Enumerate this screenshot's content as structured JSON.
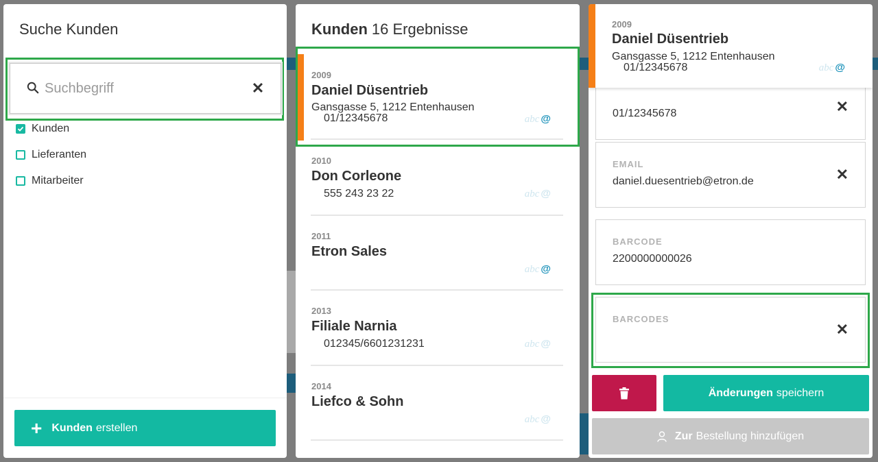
{
  "search_panel": {
    "title": "Suche Kunden",
    "search_placeholder": "Suchbegriff",
    "search_value": "",
    "filters": [
      {
        "label": "Kunden",
        "checked": true
      },
      {
        "label": "Lieferanten",
        "checked": false
      },
      {
        "label": "Mitarbeiter",
        "checked": false
      }
    ],
    "create_button": {
      "bold": "Kunden",
      "rest": "erstellen"
    }
  },
  "results_panel": {
    "title_bold": "Kunden",
    "title_rest": "16 Ergebnisse",
    "items": [
      {
        "year": "2009",
        "name": "Daniel Düsentrieb",
        "address": "Gansgasse 5, 1212 Entenhausen",
        "phone": "01/12345678",
        "abc": "abc",
        "at": "@",
        "email_active": true,
        "selected": true
      },
      {
        "year": "2010",
        "name": "Don Corleone",
        "address": "",
        "phone": "555 243 23 22",
        "abc": "abc",
        "at": "@",
        "email_active": false,
        "selected": false
      },
      {
        "year": "2011",
        "name": "Etron Sales",
        "address": "",
        "phone": "",
        "abc": "abc",
        "at": "@",
        "email_active": true,
        "selected": false
      },
      {
        "year": "2013",
        "name": "Filiale Narnia",
        "address": "",
        "phone": "012345/6601231231",
        "abc": "abc",
        "at": "@",
        "email_active": false,
        "selected": false
      },
      {
        "year": "2014",
        "name": "Liefco & Sohn",
        "address": "",
        "phone": "",
        "abc": "abc",
        "at": "@",
        "email_active": false,
        "selected": false
      }
    ]
  },
  "detail_panel": {
    "year": "2009",
    "name": "Daniel Düsentrieb",
    "address": "Gansgasse 5, 1212 Entenhausen",
    "phone": "01/12345678",
    "abc": "abc",
    "at": "@",
    "fields": [
      {
        "label": "",
        "value": "01/12345678",
        "clearable": true
      },
      {
        "label": "EMAIL",
        "value": "daniel.duesentrieb@etron.de",
        "clearable": true
      },
      {
        "label": "BARCODE",
        "value": "2200000000026",
        "clearable": false
      },
      {
        "label": "BARCODES",
        "value": "",
        "clearable": true
      }
    ],
    "save_button": {
      "bold": "Änderungen",
      "rest": "speichern"
    },
    "order_button": {
      "bold": "Zur",
      "rest": "Bestellung hinzufügen"
    },
    "clear_glyph": "✕"
  },
  "colors": {
    "accent": "#13b9a2",
    "selection": "#f57f17",
    "focus_frame": "#2ea84a",
    "delete": "#c0184b",
    "disabled": "#c7c7c7",
    "email_icon": "#168fb8"
  }
}
